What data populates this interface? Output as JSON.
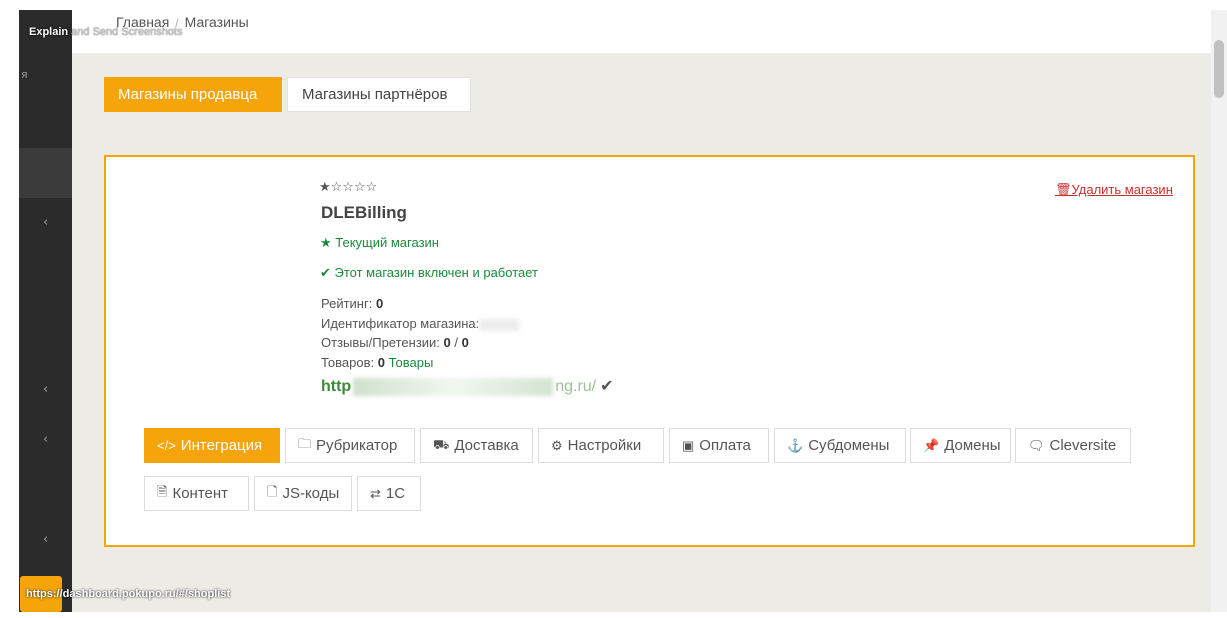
{
  "extension": {
    "label_bold": "Explain",
    "label_rest": " and Send Screenshots"
  },
  "sidebar": {
    "cut_text": "я",
    "chevron": "‹"
  },
  "breadcrumb": {
    "home": "Главная",
    "separator": "/",
    "current": "Магазины"
  },
  "tabs": {
    "seller": "Магазины продавца",
    "partners": "Магазины партнёров"
  },
  "shop": {
    "rating_stars": "★☆☆☆☆",
    "name": "DLEBilling",
    "current_label": "★ Текущий магазин",
    "enabled_label": "✔ Этот магазин включен и работает",
    "rating_label": "Рейтинг: ",
    "rating_value": "0",
    "id_label": "Идентификатор магазина:",
    "reviews_label": "Отзывы/Претензии: ",
    "reviews_positive": "0",
    "reviews_sep": " / ",
    "reviews_negative": "0",
    "products_label": "Товаров: ",
    "products_count": "0",
    "products_link": " Товары",
    "url_start": "http",
    "url_end": "ng.ru/",
    "url_check": "✔",
    "delete_label": "Удалить магазин"
  },
  "actions": {
    "integration": "Интеграция",
    "rubricator": "Рубрикатор",
    "delivery": "Доставка",
    "settings": "Настройки",
    "payment": "Оплата",
    "subdomains": "Субдомены",
    "domains": "Домены",
    "cleversite": "Cleversite",
    "content": "Контент",
    "js_codes": "JS-коды",
    "onec": "1C"
  },
  "status_bar": {
    "url": "https://dashboard.pokupo.ru/#/shoplist"
  },
  "colors": {
    "accent": "#f5a50a",
    "success": "#1a8a3a",
    "danger": "#c9302c",
    "sidebar": "#2b2b2b",
    "background": "#ecebe6"
  }
}
